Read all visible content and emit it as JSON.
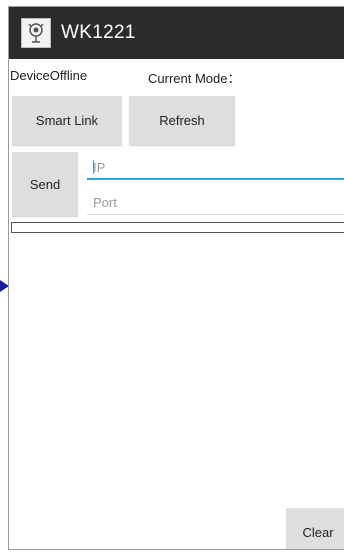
{
  "app": {
    "title": "WK1221",
    "icon": "app-logo-icon"
  },
  "status": {
    "device": "DeviceOffline",
    "mode_label": "Current Mode："
  },
  "buttons": {
    "smart_link": "Smart Link",
    "refresh": "Refresh",
    "send": "Send",
    "clear": "Clear"
  },
  "inputs": {
    "ip": {
      "value": "",
      "placeholder": "IP"
    },
    "port": {
      "value": "",
      "placeholder": "Port"
    }
  },
  "progress": {
    "percent": 0
  },
  "log": {
    "text": ""
  },
  "colors": {
    "titlebar": "#2b2b2b",
    "button": "#dedede",
    "accent": "#2aa5d6",
    "arrow": "#1a1aa8"
  }
}
